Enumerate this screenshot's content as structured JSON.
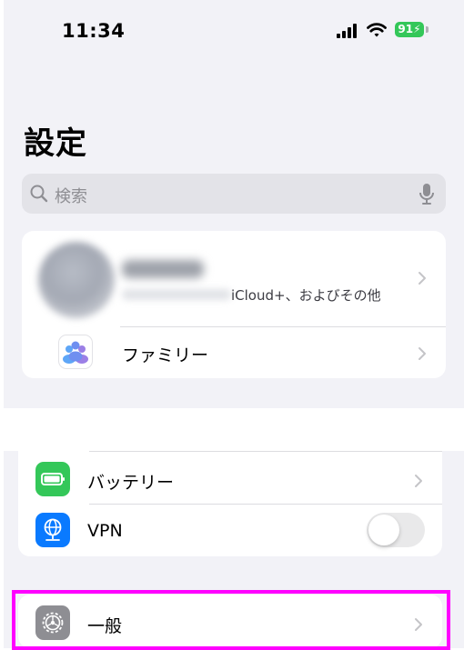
{
  "status_bar": {
    "time": "11:34",
    "battery_percent": "91",
    "battery_color": "#34c759"
  },
  "page": {
    "title": "設定"
  },
  "search": {
    "placeholder": "検索",
    "icon": "magnifying-glass",
    "mic_icon": "microphone"
  },
  "account": {
    "subtitle": "iCloud+、およびその他"
  },
  "family": {
    "label": "ファミリー",
    "icon": "family-people-icon"
  },
  "settings_items": [
    {
      "label": "バッテリー",
      "icon": "battery-icon",
      "icon_color": "#34c759"
    },
    {
      "label": "VPN",
      "icon": "globe-network-icon",
      "icon_color": "#0a7aff",
      "toggle_on": false
    }
  ],
  "general": {
    "label": "一般",
    "icon": "gear-icon",
    "icon_color": "#8e8e93",
    "highlight_color": "#ff00ff"
  }
}
